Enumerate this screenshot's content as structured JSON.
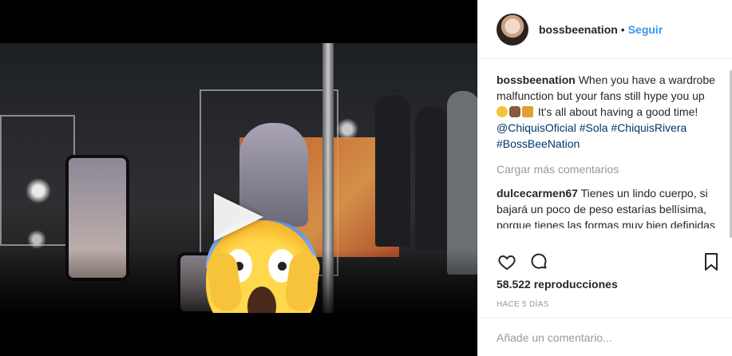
{
  "header": {
    "username": "bossbeenation",
    "separator": "•",
    "follow_label": "Seguir"
  },
  "caption": {
    "username": "bossbeenation",
    "text_1": "When you have a wardrobe malfunction but your fans still hype you up",
    "text_2": "It's all about having a good time!",
    "mention": "@ChiquisOficial",
    "tags": [
      "#Sola",
      "#ChiquisRivera",
      "#BossBeeNation"
    ]
  },
  "load_more_label": "Cargar más comentarios",
  "comment": {
    "username": "dulcecarmen67",
    "text": "Tienes un lindo cuerpo, si bajará un poco de peso estarías bellísima, porque tienes las formas muy bien definidas pero estas pasada ó peso, mi niña, y aún así, tu horrorosa Tía, Rosy"
  },
  "actions": {
    "like": "heart-icon",
    "comment": "comment-bubble-icon",
    "save": "bookmark-icon"
  },
  "views_text": "58.522 reproducciones",
  "time_ago": "HACE 5 DÍAS",
  "add_comment_placeholder": "Añade un comentario...",
  "colors": {
    "link": "#003569",
    "follow": "#3897f0",
    "muted": "#999999"
  }
}
